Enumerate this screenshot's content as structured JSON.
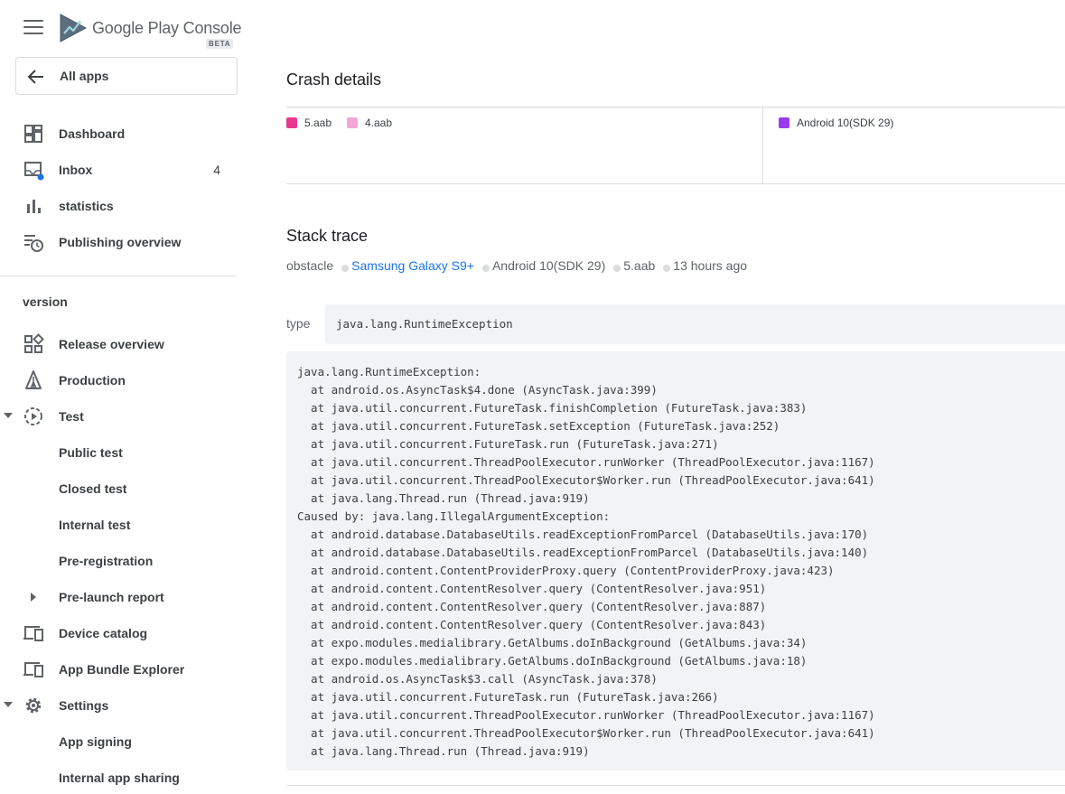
{
  "brand": {
    "name": "Google Play Console",
    "badge": "BETA"
  },
  "all_apps": {
    "label": "All apps"
  },
  "nav_top": [
    {
      "label": "Dashboard",
      "icon": "dashboard-icon"
    },
    {
      "label": "Inbox",
      "icon": "inbox-icon",
      "count": "4"
    },
    {
      "label": "statistics",
      "icon": "bar-chart-icon"
    },
    {
      "label": "Publishing overview",
      "icon": "publishing-overview-icon"
    }
  ],
  "section": {
    "title": "version"
  },
  "nav_version": [
    {
      "label": "Release overview",
      "icon": "release-overview-icon"
    },
    {
      "label": "Production",
      "icon": "production-icon"
    },
    {
      "label": "Test",
      "icon": "test-icon"
    },
    {
      "label": "Public test"
    },
    {
      "label": "Closed test"
    },
    {
      "label": "Internal test"
    },
    {
      "label": "Pre-registration"
    },
    {
      "label": "Pre-launch report"
    },
    {
      "label": "Device catalog",
      "icon": "device-catalog-icon"
    },
    {
      "label": "App Bundle Explorer",
      "icon": "app-bundle-explorer-icon"
    },
    {
      "label": "Settings",
      "icon": "gear-icon"
    },
    {
      "label": "App signing"
    },
    {
      "label": "Internal app sharing"
    }
  ],
  "main": {
    "crash_title": "Crash details",
    "legend_left": [
      {
        "label": "5.aab",
        "color": "#e8378f"
      },
      {
        "label": "4.aab",
        "color": "#f4a5d4"
      }
    ],
    "legend_right": [
      {
        "label": "Android 10(SDK 29)",
        "color": "#9b3cf0"
      }
    ],
    "stack_title": "Stack trace",
    "meta": {
      "label": "obstacle",
      "device": "Samsung Galaxy S9+",
      "os": "Android 10(SDK 29)",
      "bundle": "5.aab",
      "time": "13 hours ago"
    },
    "type": {
      "label": "type",
      "value": "java.lang.RuntimeException"
    },
    "trace": [
      "java.lang.RuntimeException:",
      "  at android.os.AsyncTask$4.done (AsyncTask.java:399)",
      "  at java.util.concurrent.FutureTask.finishCompletion (FutureTask.java:383)",
      "  at java.util.concurrent.FutureTask.setException (FutureTask.java:252)",
      "  at java.util.concurrent.FutureTask.run (FutureTask.java:271)",
      "  at java.util.concurrent.ThreadPoolExecutor.runWorker (ThreadPoolExecutor.java:1167)",
      "  at java.util.concurrent.ThreadPoolExecutor$Worker.run (ThreadPoolExecutor.java:641)",
      "  at java.lang.Thread.run (Thread.java:919)",
      "Caused by: java.lang.IllegalArgumentException:",
      "  at android.database.DatabaseUtils.readExceptionFromParcel (DatabaseUtils.java:170)",
      "  at android.database.DatabaseUtils.readExceptionFromParcel (DatabaseUtils.java:140)",
      "  at android.content.ContentProviderProxy.query (ContentProviderProxy.java:423)",
      "  at android.content.ContentResolver.query (ContentResolver.java:951)",
      "  at android.content.ContentResolver.query (ContentResolver.java:887)",
      "  at android.content.ContentResolver.query (ContentResolver.java:843)",
      "  at expo.modules.medialibrary.GetAlbums.doInBackground (GetAlbums.java:34)",
      "  at expo.modules.medialibrary.GetAlbums.doInBackground (GetAlbums.java:18)",
      "  at android.os.AsyncTask$3.call (AsyncTask.java:378)",
      "  at java.util.concurrent.FutureTask.run (FutureTask.java:266)",
      "  at java.util.concurrent.ThreadPoolExecutor.runWorker (ThreadPoolExecutor.java:1167)",
      "  at java.util.concurrent.ThreadPoolExecutor$Worker.run (ThreadPoolExecutor.java:641)",
      "  at java.lang.Thread.run (Thread.java:919)"
    ]
  }
}
